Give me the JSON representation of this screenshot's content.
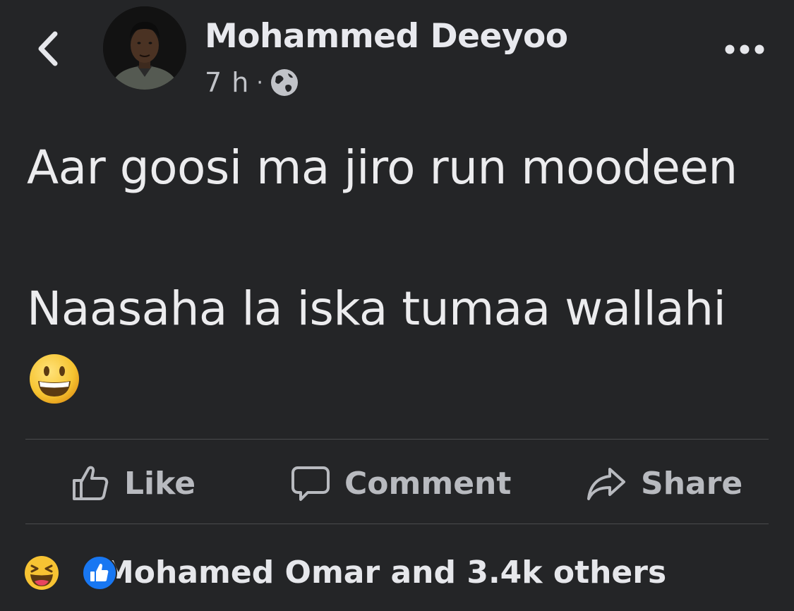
{
  "header": {
    "back_icon": "chevron-left-icon",
    "author_name": "Mohammed Deeyoo",
    "time": "7 h",
    "separator": "·",
    "privacy_icon": "globe-icon",
    "more_icon": "ellipsis-icon"
  },
  "post": {
    "line1": "Aar goosi ma jiro run moodeen",
    "line2": "Naasaha la iska tumaa wallahi",
    "emoji": "grinning-face-emoji"
  },
  "actions": {
    "like": "Like",
    "comment": "Comment",
    "share": "Share"
  },
  "reactions": {
    "icons": [
      "laughing-reaction-icon",
      "like-reaction-icon"
    ],
    "summary": "Mohamed Omar and 3.4k others"
  },
  "colors": {
    "background": "#242527",
    "text_primary": "#e4e6eb",
    "text_secondary": "#b8babf",
    "divider": "#4a4b4e",
    "like_blue": "#1877f2"
  }
}
